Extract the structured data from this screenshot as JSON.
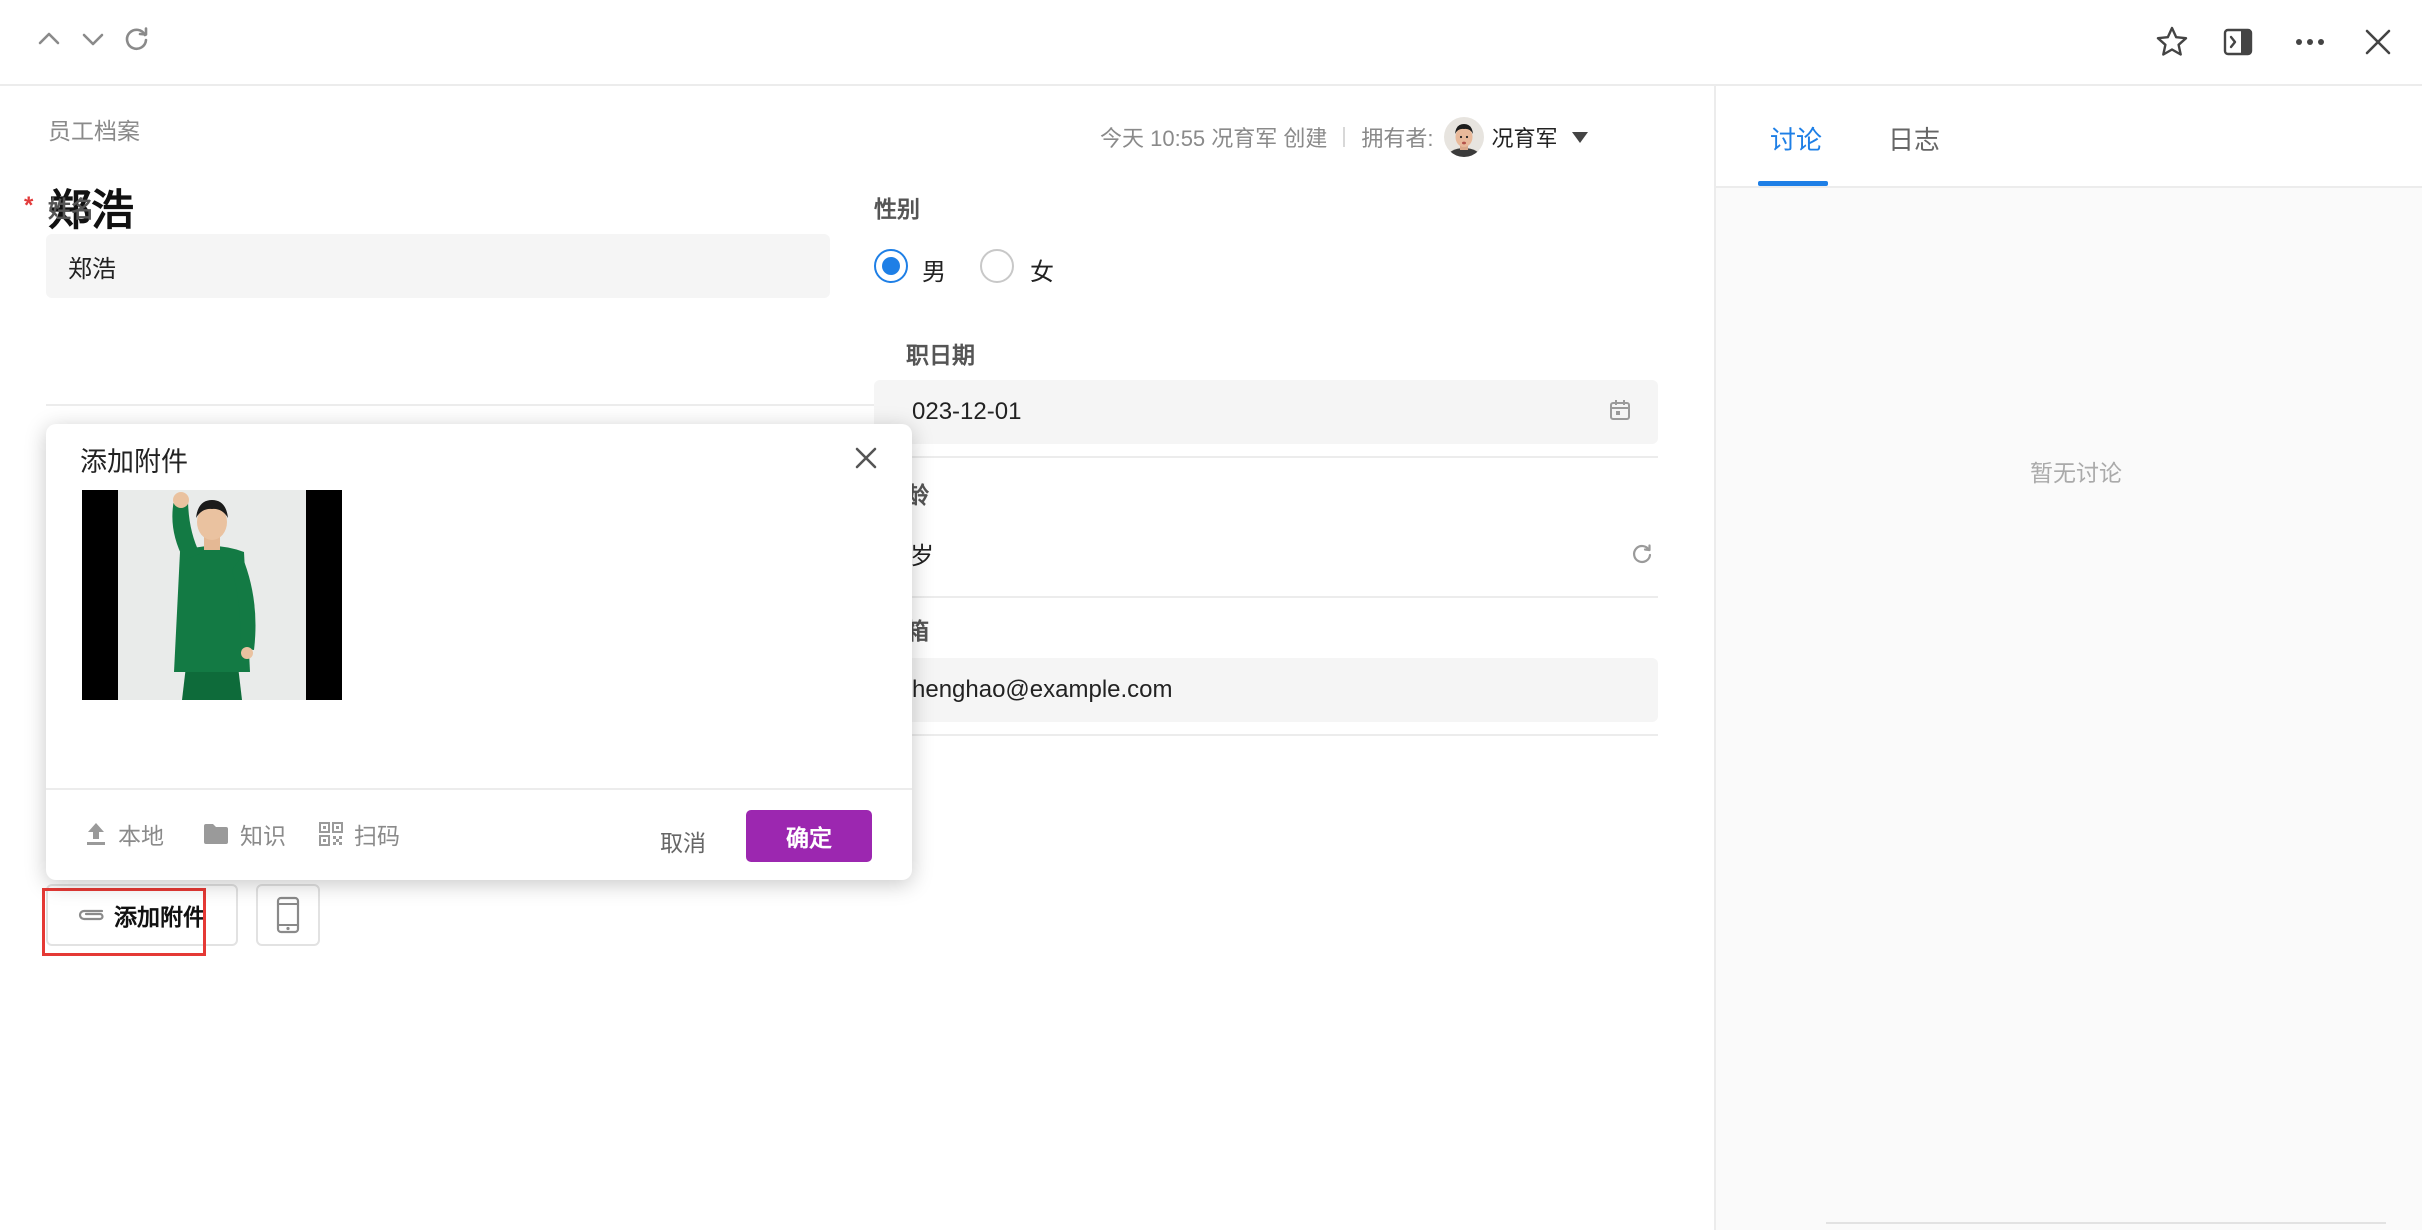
{
  "nav": {
    "icons": [
      "chevron-up-icon",
      "chevron-down-icon",
      "refresh-icon",
      "star-icon",
      "sidebar-toggle-icon",
      "more-icon",
      "close-icon"
    ]
  },
  "record": {
    "module": "员工档案",
    "created": "今天 10:55 况育军 创建",
    "owner_label": "拥有者:",
    "owner_name": "况育军",
    "title": "郑浩"
  },
  "form": {
    "name_label": "姓名",
    "name_value": "郑浩",
    "required_mark": "*",
    "gender_label": "性别",
    "gender_options": [
      "男",
      "女"
    ],
    "gender_selected": "男",
    "date_label_partial": "职日期",
    "date_value_partial": "023-12-01",
    "age_label_partial": "龄",
    "age_value_partial": "岁",
    "email_label_partial": "箱",
    "email_value_partial": "henghao@example.com",
    "attach_button": "添加附件"
  },
  "dialog": {
    "title": "添加附件",
    "sources": [
      "本地",
      "知识",
      "扫码"
    ],
    "cancel": "取消",
    "confirm": "确定"
  },
  "panel": {
    "tabs": [
      "讨论",
      "日志"
    ],
    "active_tab": "讨论",
    "empty_text": "暂无讨论"
  },
  "colors": {
    "primary_blue": "#1e7fe6",
    "confirm_purple": "#9c27b0",
    "required_red": "#e23b3b",
    "highlight_red": "#e53935"
  }
}
